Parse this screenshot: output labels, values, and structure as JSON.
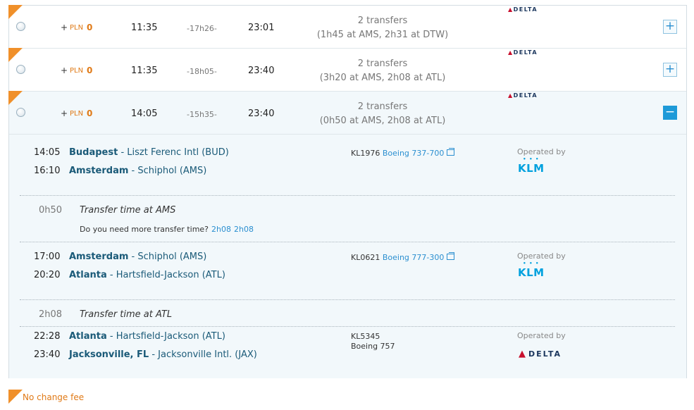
{
  "results": [
    {
      "plus": "+",
      "currency": "PLN",
      "price": "0",
      "departure": "11:35",
      "duration": "-17h26-",
      "arrival": "23:01",
      "transfers": "2 transfers",
      "transfer_detail": "(1h45 at AMS, 2h31 at DTW)",
      "airline": "DELTA",
      "toggle": "+"
    },
    {
      "plus": "+",
      "currency": "PLN",
      "price": "0",
      "departure": "11:35",
      "duration": "-18h05-",
      "arrival": "23:40",
      "transfers": "2 transfers",
      "transfer_detail": "(3h20 at AMS, 2h08 at ATL)",
      "airline": "DELTA",
      "toggle": "+"
    },
    {
      "plus": "+",
      "currency": "PLN",
      "price": "0",
      "departure": "14:05",
      "duration": "-15h35-",
      "arrival": "23:40",
      "transfers": "2 transfers",
      "transfer_detail": "(0h50 at AMS, 2h08 at ATL)",
      "airline": "DELTA",
      "toggle": "−"
    }
  ],
  "details": {
    "segments": [
      {
        "dep_time": "14:05",
        "dep_city": "Budapest",
        "dep_airport": " - Liszt Ferenc Intl (BUD)",
        "arr_time": "16:10",
        "arr_city": "Amsterdam",
        "arr_airport": " - Schiphol (AMS)",
        "flight_no": "KL1976",
        "aircraft": "Boeing 737-700",
        "operated_label": "Operated by",
        "operator": "KLM"
      },
      {
        "dep_time": "17:00",
        "dep_city": "Amsterdam",
        "dep_airport": " - Schiphol (AMS)",
        "arr_time": "20:20",
        "arr_city": "Atlanta",
        "arr_airport": " - Hartsfield-Jackson (ATL)",
        "flight_no": "KL0621",
        "aircraft": "Boeing 777-300",
        "operated_label": "Operated by",
        "operator": "KLM"
      },
      {
        "dep_time": "22:28",
        "dep_city": "Atlanta",
        "dep_airport": " - Hartsfield-Jackson (ATL)",
        "arr_time": "23:40",
        "arr_city": "Jacksonville, FL",
        "arr_airport": " - Jacksonville Intl. (JAX)",
        "flight_no": "KL5345",
        "aircraft": "Boeing 757",
        "operated_label": "Operated by",
        "operator": "DELTA"
      }
    ],
    "transfers": [
      {
        "duration": "0h50",
        "label": "Transfer time at AMS",
        "more_question": "Do you need more transfer time?",
        "options": [
          "2h08",
          "2h08"
        ]
      },
      {
        "duration": "2h08",
        "label": "Transfer time at ATL"
      }
    ]
  },
  "footer": {
    "no_change_fee": "No change fee"
  },
  "colors": {
    "accent_orange": "#f0902a",
    "link_blue": "#2b8fd0",
    "klm_blue": "#00a1de",
    "delta_red": "#c8102e",
    "delta_navy": "#1b365d"
  }
}
